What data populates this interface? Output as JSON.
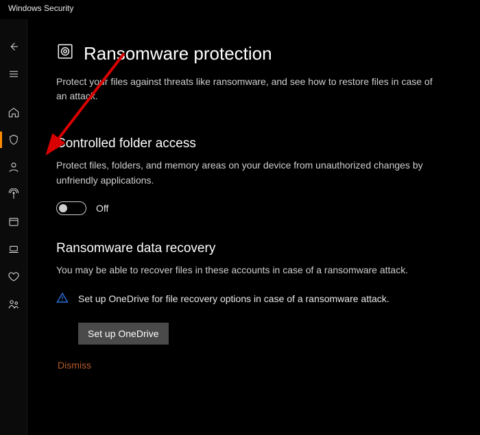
{
  "app_title": "Windows Security",
  "page": {
    "title": "Ransomware protection",
    "description": "Protect your files against threats like ransomware, and see how to restore files in case of an attack."
  },
  "sections": {
    "controlled_folder_access": {
      "title": "Controlled folder access",
      "description": "Protect files, folders, and memory areas on your device from unauthorized changes by unfriendly applications.",
      "toggle_state": "Off"
    },
    "data_recovery": {
      "title": "Ransomware data recovery",
      "description": "You may be able to recover files in these accounts in case of a ransomware attack.",
      "alert_text": "Set up OneDrive for file recovery options in case of a ransomware attack.",
      "button_label": "Set up OneDrive",
      "dismiss_label": "Dismiss"
    }
  },
  "sidebar": {
    "items": [
      {
        "name": "back"
      },
      {
        "name": "menu"
      },
      {
        "name": "home"
      },
      {
        "name": "shield",
        "active": true
      },
      {
        "name": "account"
      },
      {
        "name": "firewall"
      },
      {
        "name": "app-browser"
      },
      {
        "name": "device-security"
      },
      {
        "name": "device-health"
      },
      {
        "name": "family"
      }
    ]
  }
}
